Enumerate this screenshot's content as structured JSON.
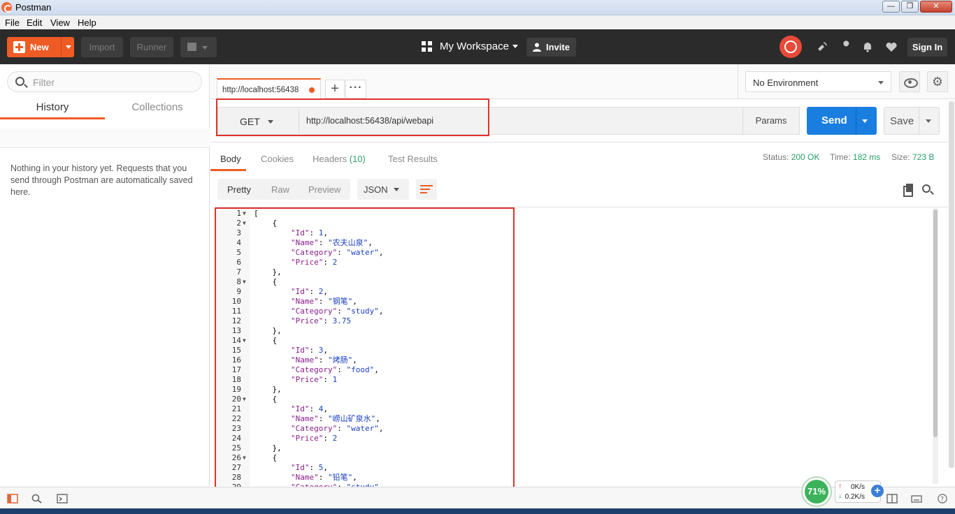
{
  "window": {
    "title": "Postman",
    "min": "—",
    "max": "❐",
    "close": "✕"
  },
  "menu": [
    "File",
    "Edit",
    "View",
    "Help"
  ],
  "header": {
    "new_label": "New",
    "import_label": "Import",
    "runner_label": "Runner",
    "workspace_label": "My Workspace",
    "invite_label": "Invite",
    "signin_label": "Sign In"
  },
  "sidebar": {
    "filter_placeholder": "Filter",
    "tabs": [
      "History",
      "Collections"
    ],
    "empty_message": "Nothing in your history yet. Requests that you send through Postman are automatically saved here."
  },
  "request_tab": {
    "label": "http://localhost:56438"
  },
  "environment": {
    "selected": "No Environment"
  },
  "request": {
    "method": "GET",
    "url": "http://localhost:56438/api/webapi",
    "params_label": "Params",
    "send_label": "Send",
    "save_label": "Save"
  },
  "response": {
    "tabs": {
      "body": "Body",
      "cookies": "Cookies",
      "headers": "Headers",
      "headers_count": "(10)",
      "tests": "Test Results"
    },
    "status_label": "Status:",
    "status_value": "200 OK",
    "time_label": "Time:",
    "time_value": "182 ms",
    "size_label": "Size:",
    "size_value": "723 B",
    "format_modes": [
      "Pretty",
      "Raw",
      "Preview"
    ],
    "format_type": "JSON"
  },
  "code_lines": [
    {
      "n": "1",
      "fold": true,
      "t": "["
    },
    {
      "n": "2",
      "fold": true,
      "t": "    {"
    },
    {
      "n": "3",
      "t": "        \"Id\": 1,"
    },
    {
      "n": "4",
      "t": "        \"Name\": \"农夫山泉\","
    },
    {
      "n": "5",
      "t": "        \"Category\": \"water\","
    },
    {
      "n": "6",
      "t": "        \"Price\": 2"
    },
    {
      "n": "7",
      "t": "    },"
    },
    {
      "n": "8",
      "fold": true,
      "t": "    {"
    },
    {
      "n": "9",
      "t": "        \"Id\": 2,"
    },
    {
      "n": "10",
      "t": "        \"Name\": \"钢笔\","
    },
    {
      "n": "11",
      "t": "        \"Category\": \"study\","
    },
    {
      "n": "12",
      "t": "        \"Price\": 3.75"
    },
    {
      "n": "13",
      "t": "    },"
    },
    {
      "n": "14",
      "fold": true,
      "t": "    {"
    },
    {
      "n": "15",
      "t": "        \"Id\": 3,"
    },
    {
      "n": "16",
      "t": "        \"Name\": \"烤肠\","
    },
    {
      "n": "17",
      "t": "        \"Category\": \"food\","
    },
    {
      "n": "18",
      "t": "        \"Price\": 1"
    },
    {
      "n": "19",
      "t": "    },"
    },
    {
      "n": "20",
      "fold": true,
      "t": "    {"
    },
    {
      "n": "21",
      "t": "        \"Id\": 4,"
    },
    {
      "n": "22",
      "t": "        \"Name\": \"崂山矿泉水\","
    },
    {
      "n": "23",
      "t": "        \"Category\": \"water\","
    },
    {
      "n": "24",
      "t": "        \"Price\": 2"
    },
    {
      "n": "25",
      "t": "    },"
    },
    {
      "n": "26",
      "fold": true,
      "t": "    {"
    },
    {
      "n": "27",
      "t": "        \"Id\": 5,"
    },
    {
      "n": "28",
      "t": "        \"Name\": \"铅笔\","
    },
    {
      "n": "29",
      "t": "        \"Category\": \"study\","
    }
  ],
  "net_widget": {
    "percent": "71%",
    "upload": "0K/s",
    "download": "0.2K/s"
  },
  "colors": {
    "accent": "#ef5b25",
    "send": "#1a7ee0",
    "status_ok": "#2aa06b",
    "highlight_box": "#e3322b"
  }
}
